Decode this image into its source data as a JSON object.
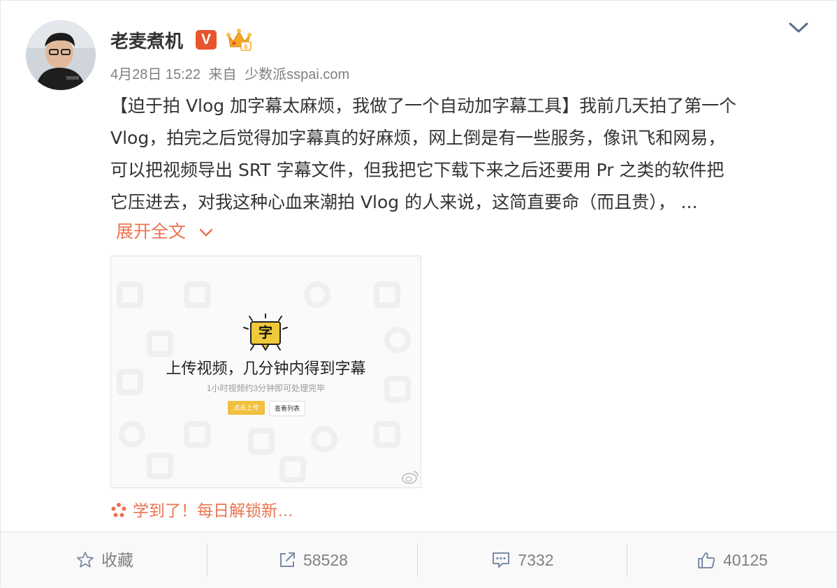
{
  "header": {
    "username": "老麦煮机",
    "verified_badge": "V",
    "timestamp": "4月28日 15:22",
    "source_prefix": "来自",
    "source": "少数派sspai.com"
  },
  "post": {
    "lines": [
      "【迫于拍 Vlog 加字幕太麻烦，我做了一个自动加字幕工具】我前几天拍了第一个",
      "Vlog，拍完之后觉得加字幕真的好麻烦，网上倒是有一些服务，像讯飞和网易，",
      "可以把视频导出 SRT 字幕文件，但我把它下载下来之后还要用 Pr 之类的软件把",
      "它压进去，对我这种心血来潮拍 Vlog 的人来说，这简直要命（而且贵），  ..."
    ],
    "expand_label": "展开全文"
  },
  "image": {
    "title": "上传视频，几分钟内得到字幕",
    "subtitle": "1小时视频约3分钟即可处理完毕",
    "primary_button": "点击上传",
    "secondary_button": "查看列表"
  },
  "topic": {
    "label": "学到了！每日解锁新…"
  },
  "actions": {
    "favorite_label": "收藏",
    "repost_count": "58528",
    "comment_count": "7332",
    "like_count": "40125"
  },
  "colors": {
    "accent": "#eb7350",
    "badge": "#e8542e",
    "muted": "#808080"
  }
}
